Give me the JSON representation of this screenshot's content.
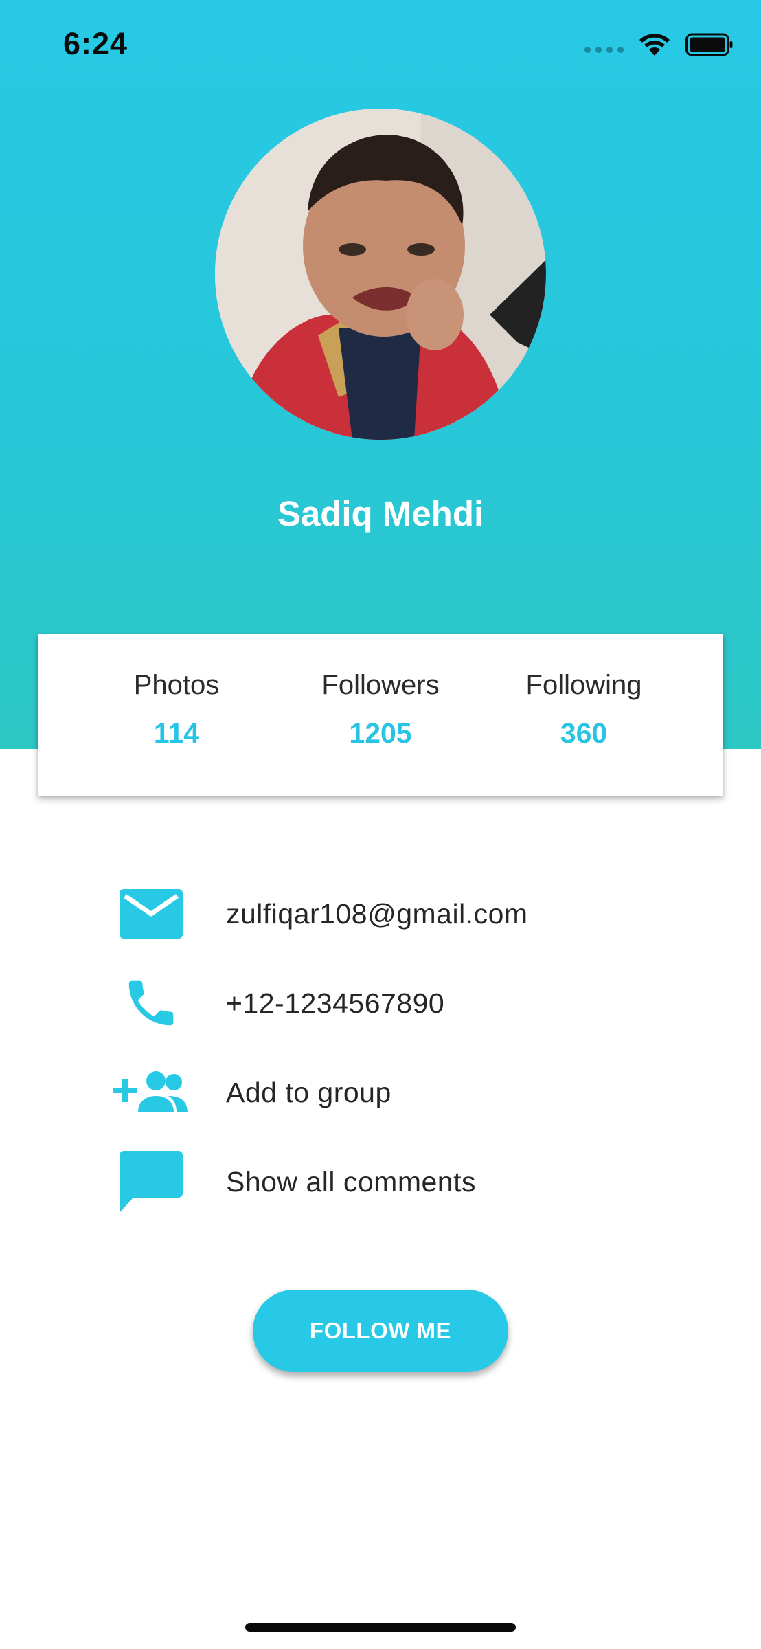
{
  "status_bar": {
    "time": "6:24",
    "icons": [
      "signal-dots-icon",
      "wifi-icon",
      "battery-icon"
    ]
  },
  "profile": {
    "name": "Sadiq Mehdi",
    "avatar": "profile-photo"
  },
  "stats": [
    {
      "label": "Photos",
      "value": "114"
    },
    {
      "label": "Followers",
      "value": "1205"
    },
    {
      "label": "Following",
      "value": "360"
    }
  ],
  "info": [
    {
      "icon": "mail-icon",
      "text": "zulfiqar108@gmail.com"
    },
    {
      "icon": "phone-icon",
      "text": "+12-1234567890"
    },
    {
      "icon": "group-add-icon",
      "text": "Add to group"
    },
    {
      "icon": "comment-icon",
      "text": "Show all comments"
    }
  ],
  "follow_button": {
    "label": "FOLLOW ME"
  },
  "colors": {
    "accent": "#27c9e5",
    "accent_teal": "#2dc7c4",
    "text": "#262626",
    "white": "#ffffff"
  }
}
